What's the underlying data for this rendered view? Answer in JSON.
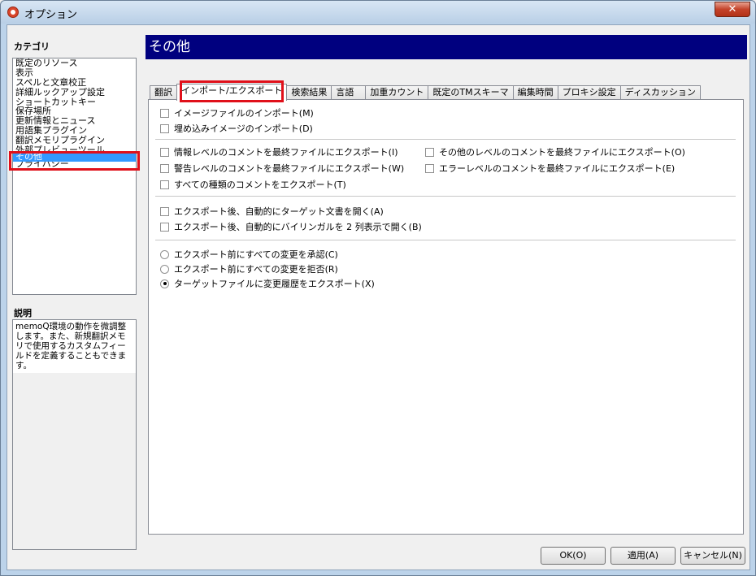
{
  "window": {
    "title": "オプション",
    "close_symbol": "✕"
  },
  "sidebar": {
    "header": "カテゴリ",
    "items": [
      {
        "label": "既定のリソース"
      },
      {
        "label": "表示"
      },
      {
        "label": "スペルと文章校正"
      },
      {
        "label": "詳細ルックアップ設定"
      },
      {
        "label": "ショートカットキー"
      },
      {
        "label": "保存場所"
      },
      {
        "label": "更新情報とニュース"
      },
      {
        "label": "用語集プラグイン"
      },
      {
        "label": "翻訳メモリプラグイン"
      },
      {
        "label": "外部プレビューツール"
      },
      {
        "label": "その他",
        "selected": true
      },
      {
        "label": "プライバシー"
      }
    ]
  },
  "description": {
    "header": "説明",
    "text": "memoQ環境の動作を微調整します。また、新規翻訳メモリで使用するカスタムフィールドを定義することもできます。"
  },
  "main": {
    "title": "その他",
    "tabs": [
      {
        "label": "翻訳"
      },
      {
        "label": "インポート/エクスポート",
        "active": true
      },
      {
        "label": "検索結果"
      },
      {
        "label": "言語"
      },
      {
        "label": "加重カウント"
      },
      {
        "label": "既定のTMスキーマ"
      },
      {
        "label": "編集時間"
      },
      {
        "label": "プロキシ設定"
      },
      {
        "label": "ディスカッション"
      }
    ],
    "options": {
      "import_image": {
        "label": "イメージファイルのインポート(M)",
        "checked": false
      },
      "import_embedded": {
        "label": "埋め込みイメージのインポート(D)",
        "checked": false
      },
      "export_info_comments": {
        "label": "情報レベルのコメントを最終ファイルにエクスポート(I)",
        "checked": false
      },
      "export_other_comments": {
        "label": "その他のレベルのコメントを最終ファイルにエクスポート(O)",
        "checked": false
      },
      "export_warning_comments": {
        "label": "警告レベルのコメントを最終ファイルにエクスポート(W)",
        "checked": false
      },
      "export_error_comments": {
        "label": "エラーレベルのコメントを最終ファイルにエクスポート(E)",
        "checked": false
      },
      "export_all_comments": {
        "label": "すべての種類のコメントをエクスポート(T)",
        "checked": false
      },
      "open_target_after": {
        "label": "エクスポート後、自動的にターゲット文書を開く(A)",
        "checked": false
      },
      "open_bilingual_after": {
        "label": "エクスポート後、自動的にバイリンガルを 2 列表示で開く(B)",
        "checked": false
      },
      "radio_confirm": {
        "label": "エクスポート前にすべての変更を承認(C)",
        "selected": false
      },
      "radio_reject": {
        "label": "エクスポート前にすべての変更を拒否(R)",
        "selected": false
      },
      "radio_track": {
        "label": "ターゲットファイルに変更履歴をエクスポート(X)",
        "selected": true
      }
    }
  },
  "footer": {
    "ok": "OK(O)",
    "apply": "適用(A)",
    "cancel": "キャンセル(N)"
  },
  "colors": {
    "title_band": "#00007f",
    "selection": "#3399ff",
    "highlight_border": "#e0101a"
  }
}
